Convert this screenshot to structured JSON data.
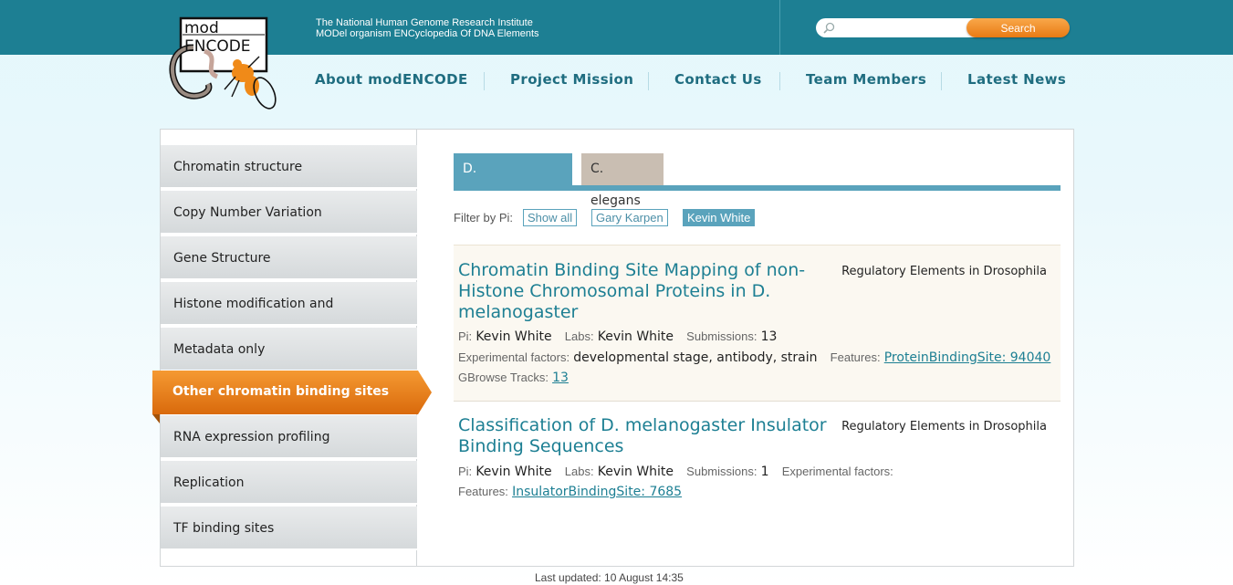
{
  "header": {
    "tagline_line1": "The National Human Genome Research Institute",
    "tagline_line2": "MODel organism ENCyclopedia Of DNA Elements",
    "logo_text_top": "mod",
    "logo_text_bottom": "ENCODE",
    "search": {
      "value": "",
      "placeholder": "",
      "button_label": "Search"
    }
  },
  "nav": {
    "items": [
      "About modENCODE",
      "Project Mission",
      "Contact Us",
      "Team Members",
      "Latest News"
    ]
  },
  "sidebar": {
    "items": [
      "Chromatin structure",
      "Copy Number Variation",
      "Gene Structure",
      "Histone modification and replacement",
      "Metadata only",
      "Other chromatin binding sites",
      "RNA expression profiling",
      "Replication",
      "TF binding sites"
    ],
    "active_index": 5
  },
  "tabs": {
    "items": [
      "D. melanogaster",
      "C. elegans"
    ],
    "active_index": 0
  },
  "filter": {
    "label": "Filter by Pi:",
    "options": [
      "Show all",
      "Gary Karpen",
      "Kevin White"
    ],
    "active": "Kevin White"
  },
  "results": [
    {
      "title": "Chromatin Binding Site Mapping of non-Histone Chromosomal Proteins in D. melanogaster",
      "category": "Regulatory Elements in Drosophila",
      "pi_label": "Pi:",
      "pi": "Kevin White",
      "labs_label": "Labs:",
      "labs": "Kevin White",
      "submissions_label": "Submissions:",
      "submissions": "13",
      "factors_label": "Experimental factors:",
      "factors": "developmental stage, antibody, strain",
      "features_label": "Features:",
      "features": "ProteinBindingSite: 94040",
      "gbrowse_label": "GBrowse Tracks:",
      "gbrowse": "13"
    },
    {
      "title": "Classification of D. melanogaster Insulator Binding Sequences",
      "category": "Regulatory Elements in Drosophila",
      "pi_label": "Pi:",
      "pi": "Kevin White",
      "labs_label": "Labs:",
      "labs": "Kevin White",
      "submissions_label": "Submissions:",
      "submissions": "1",
      "factors_label": "Experimental factors:",
      "factors": "",
      "features_label": "Features:",
      "features": "InsulatorBindingSite: 7685"
    }
  ],
  "footer": {
    "text": "Last updated: 10 August 14:35"
  },
  "colors": {
    "header_bar": "#1d7f93",
    "accent_blue": "#5aa3bc",
    "accent_orange": "#e87a14",
    "tab_inactive": "#c9beb2",
    "link": "#1d7f93"
  }
}
